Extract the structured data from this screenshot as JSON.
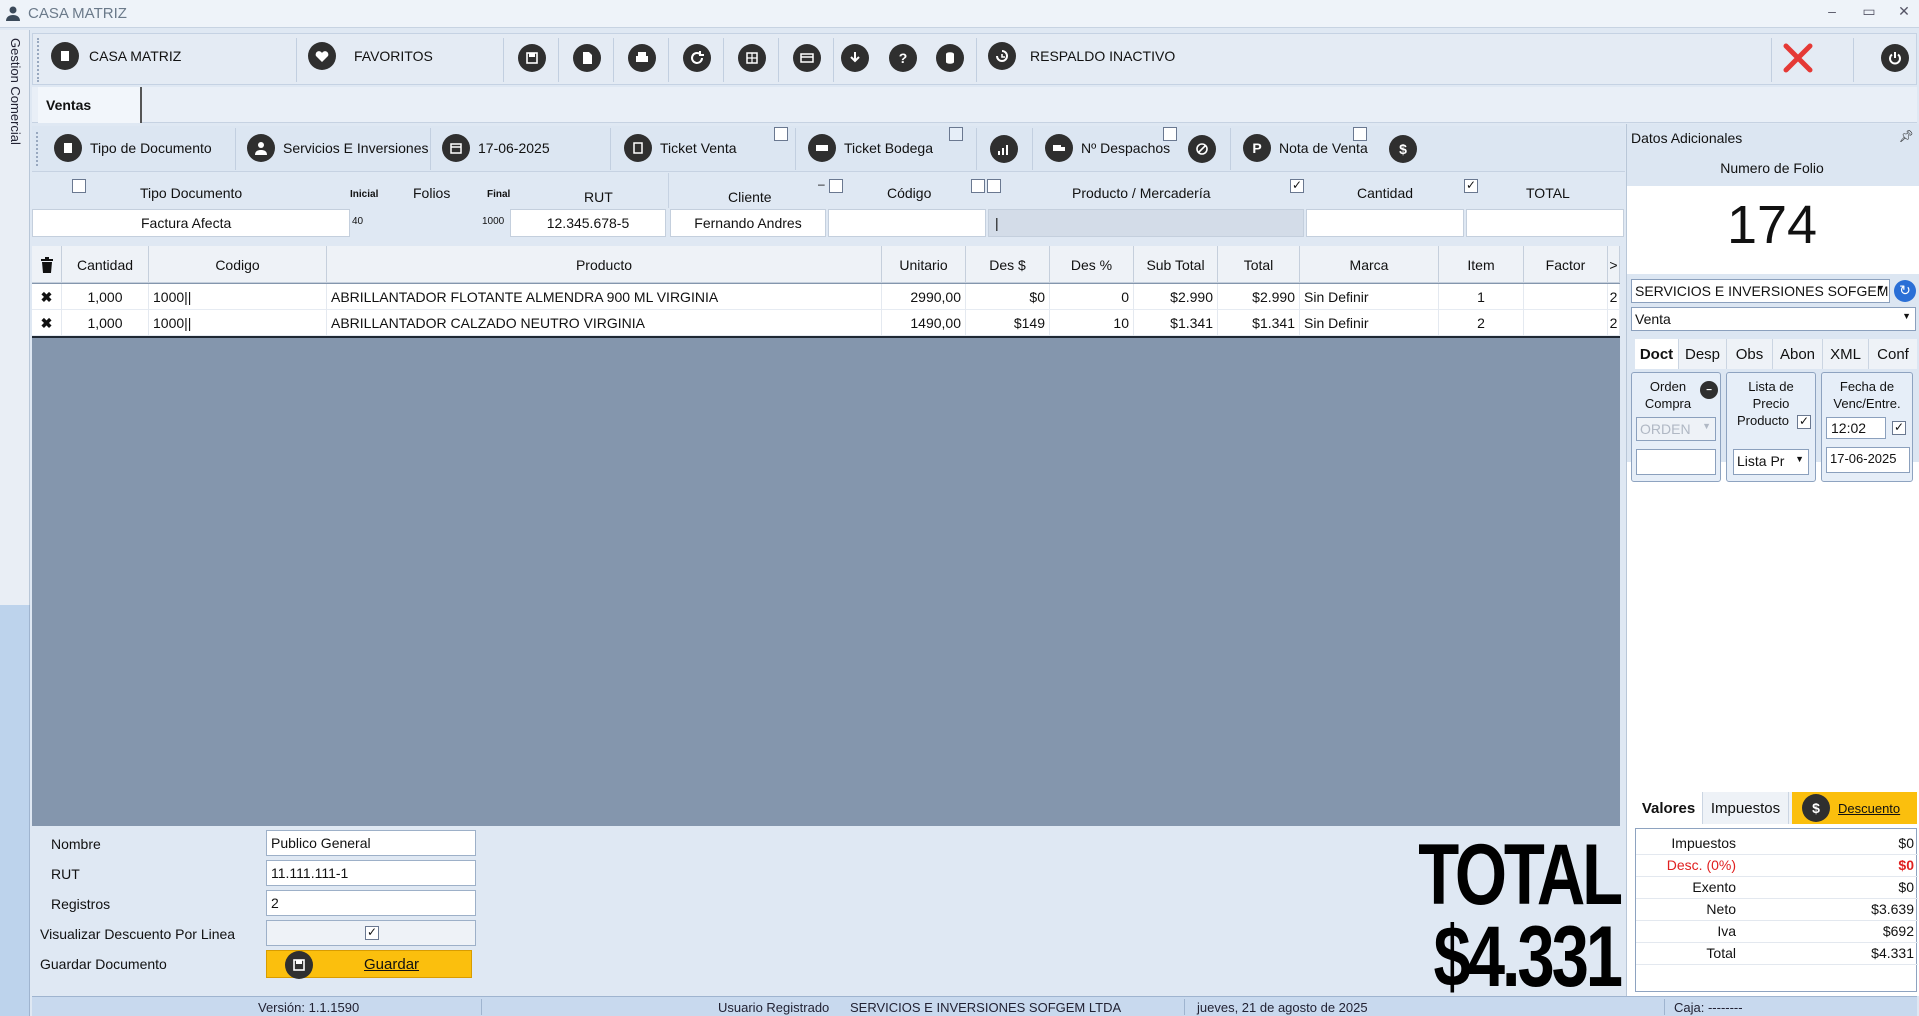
{
  "window": {
    "title": "CASA MATRIZ",
    "controls": [
      "–",
      "▭",
      "✕"
    ],
    "side_tab": "Gestion Comercial"
  },
  "toolbar": {
    "casa_matriz": "CASA MATRIZ",
    "favoritos": "FAVORITOS",
    "respaldo": "RESPALDO INACTIVO"
  },
  "tabs": {
    "ventas": "Ventas"
  },
  "doc_toolbar": {
    "tipo_documento": "Tipo de Documento",
    "cliente": "Servicios E Inversiones",
    "fecha": "17-06-2025",
    "ticket_venta": "Ticket Venta",
    "ticket_bodega": "Ticket Bodega",
    "despachos": "Nº Despachos",
    "nota_venta": "Nota de Venta"
  },
  "header_labels": {
    "tipo_documento": "Tipo Documento",
    "inicial": "Inicial",
    "folios": "Folios",
    "final": "Final",
    "rut": "RUT",
    "cliente": "Cliente",
    "codigo": "Código",
    "producto": "Producto / Mercadería",
    "cantidad": "Cantidad",
    "total": "TOTAL"
  },
  "header_values": {
    "tipo_documento": "Factura Afecta",
    "inicial": "40",
    "final": "1000",
    "rut": "12.345.678-5",
    "cliente": "Fernando Andres",
    "codigo": "",
    "producto": "|",
    "cantidad": "",
    "total": ""
  },
  "grid": {
    "columns": [
      "Cantidad",
      "Codigo",
      "Producto",
      "Unitario",
      "Des $",
      "Des %",
      "Sub Total",
      "Total",
      "Marca",
      "Item",
      "Factor",
      ">"
    ],
    "rows": [
      {
        "cantidad": "1,000",
        "codigo": "1000||",
        "producto": "ABRILLANTADOR FLOTANTE ALMENDRA 900 ML VIRGINIA",
        "unitario": "2990,00",
        "des_monto": "$0",
        "des_pct": "0",
        "subtotal": "$2.990",
        "total": "$2.990",
        "marca": "Sin Definir",
        "item": "1",
        "factor": "",
        "extra": "2"
      },
      {
        "cantidad": "1,000",
        "codigo": "1000||",
        "producto": "ABRILLANTADOR CALZADO NEUTRO VIRGINIA",
        "unitario": "1490,00",
        "des_monto": "$149",
        "des_pct": "10",
        "subtotal": "$1.341",
        "total": "$1.341",
        "marca": "Sin Definir",
        "item": "2",
        "factor": "",
        "extra": "2"
      }
    ]
  },
  "form": {
    "nombre_label": "Nombre",
    "nombre_value": "Publico General",
    "rut_label": "RUT",
    "rut_value": "11.111.111-1",
    "registros_label": "Registros",
    "registros_value": "2",
    "visualizar_label": "Visualizar Descuento Por Linea",
    "guardar_label": "Guardar Documento",
    "guardar_button": "Guardar"
  },
  "total": {
    "label": "TOTAL",
    "value": "$4.331"
  },
  "statusbar": {
    "version": "Versión: 1.1.1590",
    "usuario": "Usuario Registrado",
    "empresa": "SERVICIOS E INVERSIONES SOFGEM LTDA",
    "fecha": "jueves, 21 de agosto de 2025",
    "caja": "Caja: --------"
  },
  "right_panel": {
    "title": "Datos Adicionales",
    "folio_label": "Numero de Folio",
    "folio": "174",
    "empresa_combo": "SERVICIOS E INVERSIONES SOFGEM",
    "tipo_combo": "Venta",
    "tabs": [
      "Doct",
      "Desp",
      "Obs",
      "Abon",
      "XML",
      "Conf"
    ],
    "orden_compra": {
      "label1": "Orden",
      "label2": "Compra",
      "combo": "ORDEN"
    },
    "lista_precio": {
      "label1": "Lista de",
      "label2": "Precio",
      "label3": "Producto",
      "combo": "Lista Pr"
    },
    "fecha_venc": {
      "label1": "Fecha de",
      "label2": "Venc/Entre.",
      "hora": "12:02",
      "fecha": "17-06-2025"
    },
    "valores_tabs": [
      "Valores",
      "Impuestos",
      "Descuento"
    ],
    "valores": [
      {
        "label": "Impuestos",
        "value": "$0",
        "red": false
      },
      {
        "label": "Desc. (0%)",
        "value": "$0",
        "red": true
      },
      {
        "label": "Exento",
        "value": "$0",
        "red": false
      },
      {
        "label": "Neto",
        "value": "$3.639",
        "red": false
      },
      {
        "label": "Iva",
        "value": "$692",
        "red": false
      },
      {
        "label": "Total",
        "value": "$4.331",
        "red": false
      }
    ]
  },
  "colors": {
    "accent": "#fbbf0d",
    "grid_bg": "#8496ad",
    "red": "#e02020",
    "close_red": "#e53935"
  }
}
